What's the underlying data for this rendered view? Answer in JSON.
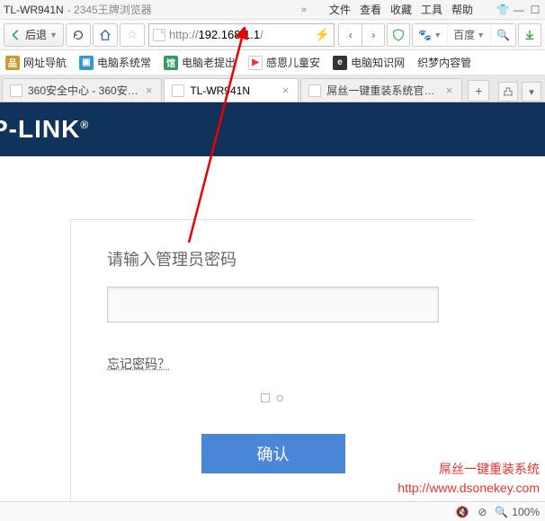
{
  "titlebar": {
    "title": "TL-WR941N",
    "subtitle": "- 2345王牌浏览器"
  },
  "menus": {
    "file": "文件",
    "view": "查看",
    "fav": "收藏",
    "tools": "工具",
    "help": "帮助"
  },
  "toolbar": {
    "back_label": "后退",
    "url_proto": "http://",
    "url_host": "192.168.1.1",
    "url_path": "/",
    "search_engine": "百度"
  },
  "bookmarks": {
    "b1": "网址导航",
    "b2": "电脑系统常",
    "b3": "电脑老提出",
    "b4": "感恩儿童安",
    "b5": "电脑知识网",
    "b6": "织梦内容管"
  },
  "tabs": {
    "t1": "360安全中心 - 360安…",
    "t2": "TL-WR941N",
    "t3": "屌丝一键重装系统官网_…"
  },
  "page": {
    "brand": "P-LINK",
    "login_title": "请输入管理员密码",
    "forgot": "忘记密码？",
    "extra": "□ ○",
    "submit": "确认"
  },
  "watermark": {
    "line1": "屌丝一键重装系统",
    "line2": "http://www.dsonekey.com"
  },
  "status": {
    "zoom": "100%"
  }
}
